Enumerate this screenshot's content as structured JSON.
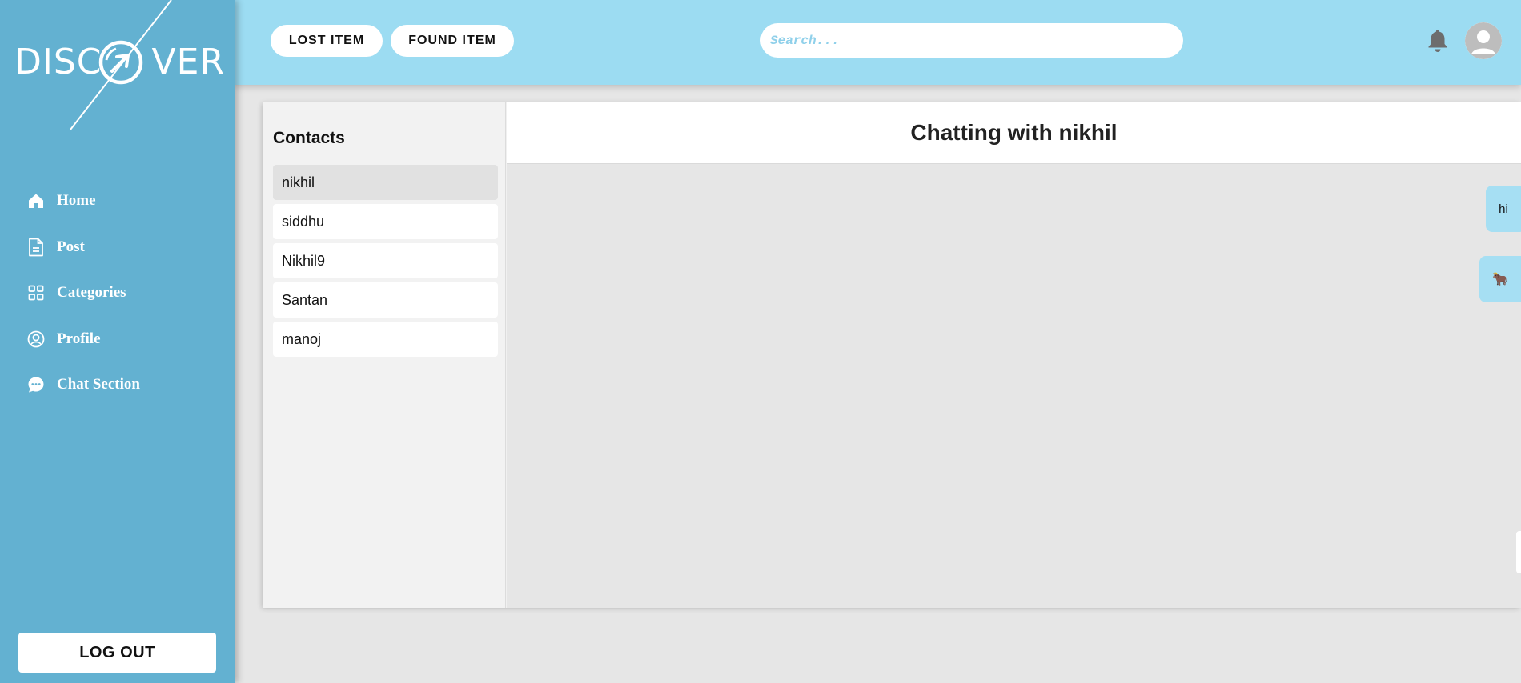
{
  "brand": {
    "logo_text_left": "DISC",
    "logo_text_right": "VER",
    "colors": {
      "sidebar": "#63b1d1",
      "header": "#9cdcf2",
      "bubble": "#a6dff3"
    }
  },
  "sidebar": {
    "items": [
      {
        "label": "Home",
        "icon": "home-icon"
      },
      {
        "label": "Post",
        "icon": "document-icon"
      },
      {
        "label": "Categories",
        "icon": "grid-icon"
      },
      {
        "label": "Profile",
        "icon": "user-circle-icon"
      },
      {
        "label": "Chat Section",
        "icon": "chat-bubble-icon"
      }
    ],
    "logout_label": "LOG OUT"
  },
  "header": {
    "lost_label": "LOST ITEM",
    "found_label": "FOUND ITEM",
    "search_placeholder": "Search...",
    "notification_icon": "bell-icon",
    "avatar_icon": "user-avatar-icon"
  },
  "contacts": {
    "title": "Contacts",
    "items": [
      "nikhil",
      "siddhu",
      "Nikhil9",
      "Santan",
      "manoj"
    ],
    "active": "nikhil"
  },
  "chat": {
    "title": "Chatting with nikhil",
    "messages": [
      {
        "text": "hi",
        "side": "sent"
      },
      {
        "text": "🐂",
        "side": "sent"
      }
    ]
  }
}
